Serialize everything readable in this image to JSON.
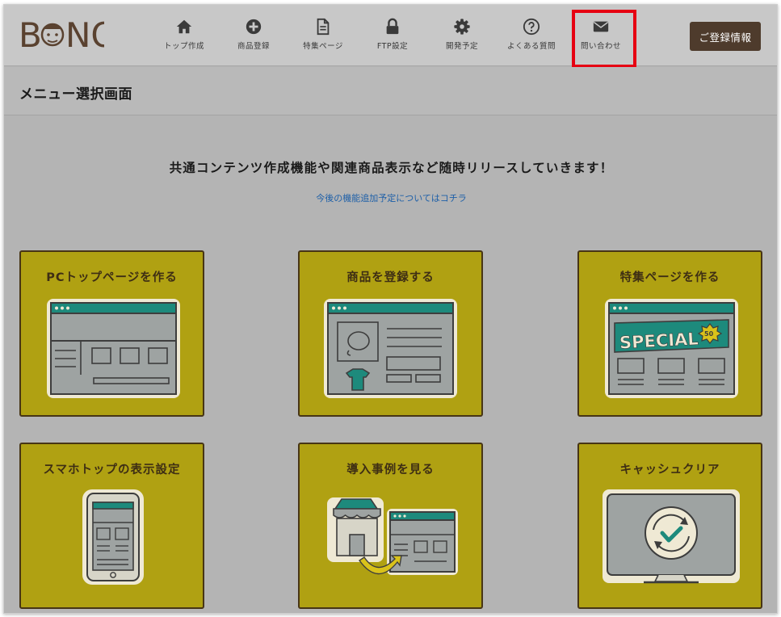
{
  "header": {
    "logo_text": "BONO",
    "nav": [
      {
        "label": "トップ作成",
        "icon": "home-icon"
      },
      {
        "label": "商品登録",
        "icon": "plus-circle-icon"
      },
      {
        "label": "特集ページ",
        "icon": "file-icon"
      },
      {
        "label": "FTP設定",
        "icon": "lock-icon"
      },
      {
        "label": "開発予定",
        "icon": "gear-icon"
      },
      {
        "label": "よくある質問",
        "icon": "question-icon"
      },
      {
        "label": "問い合わせ",
        "icon": "envelope-icon"
      }
    ],
    "register_label": "ご登録情報"
  },
  "page_title": "メニュー選択画面",
  "headline": "共通コンテンツ作成機能や関連商品表示など随時リリースしていきます！",
  "link_text": "今後の機能追加予定についてはコチラ",
  "cards": [
    {
      "title": "PCトップページを作る",
      "icon": "pc-browser-illustration"
    },
    {
      "title": "商品を登録する",
      "icon": "product-page-illustration"
    },
    {
      "title": "特集ページを作る",
      "icon": "special-page-illustration"
    },
    {
      "title": "スマホトップの表示設定",
      "icon": "smartphone-illustration"
    },
    {
      "title": "導入事例を見る",
      "icon": "shop-case-illustration"
    },
    {
      "title": "キャッシュクリア",
      "icon": "refresh-monitor-illustration"
    }
  ],
  "illustration_texts": {
    "special": "SPECIAL",
    "badge": "50"
  },
  "colors": {
    "card_bg": "#b0a112",
    "card_border": "#473515",
    "header_bg": "#c8c8c8",
    "register_bg": "#4e3b2c",
    "highlight": "#e60012",
    "teal": "#1d8a7c",
    "link": "#1d5fa8"
  }
}
